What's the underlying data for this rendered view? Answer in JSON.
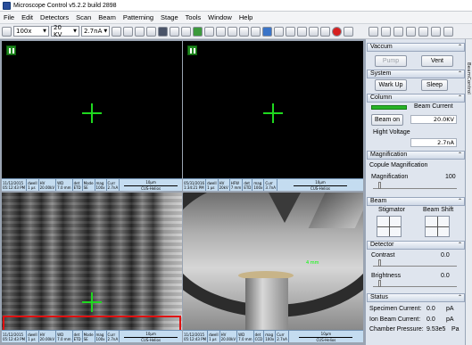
{
  "window": {
    "title": "Microscope Control v5.2.2 build 2898"
  },
  "menu": [
    "File",
    "Edit",
    "Detectors",
    "Scan",
    "Beam",
    "Patterning",
    "Stage",
    "Tools",
    "Window",
    "Help"
  ],
  "toolbar": {
    "magnification": "100x",
    "voltage": "20 KV",
    "current": "2.7nA"
  },
  "views": [
    {
      "info": [
        "11/12/2015",
        "05:12:43 PM",
        "dwell",
        "1 µs",
        "HV",
        "20.00kV",
        "WD",
        "7.0 mm",
        "det",
        "ETD",
        "Mode",
        "SE",
        "mag",
        "100x",
        "Curr",
        "2.7nA"
      ],
      "scale": "10µm",
      "footer": "CUS-Helios"
    },
    {
      "info": [
        "05/31/2016",
        "1:34:21 PM",
        "dwell",
        "1 µs",
        "HV",
        "20kV",
        "HFW",
        "7 mm",
        "det",
        "ETD",
        "mag",
        "100x",
        "Curr",
        "3.7nA"
      ],
      "scale": "10µm",
      "footer": "CUS-Helios"
    },
    {
      "info": [
        "11/12/2015",
        "05:12:43 PM",
        "dwell",
        "1 µs",
        "HV",
        "20.00kV",
        "WD",
        "7.0 mm",
        "det",
        "ETD",
        "Mode",
        "SE",
        "mag",
        "100x",
        "Curr",
        "2.7nA"
      ],
      "scale": "10µm",
      "footer": "CUS-Helios"
    },
    {
      "info": [
        "11/12/2015",
        "05:12:43 PM",
        "dwell",
        "1 µs",
        "HV",
        "20.00kV",
        "WD",
        "7.0 mm",
        "det",
        "CCD",
        "mag",
        "100x",
        "Curr",
        "2.7nA"
      ],
      "scale": "10µm",
      "footer": "CUS-Helios",
      "overlay": "4 mm"
    }
  ],
  "panel": {
    "vaccum": {
      "title": "Vaccum",
      "pump": "Pump",
      "vent": "Vent"
    },
    "system": {
      "title": "System",
      "warkup": "Wark Up",
      "sleep": "Sleep"
    },
    "column": {
      "title": "Column",
      "beam_current": "Beam Current",
      "beam_on": "Beam on",
      "kv": "20.0KV",
      "hight_voltage": "Hight Voltage",
      "na": "2.7nA"
    },
    "magnification": {
      "title": "Magnification",
      "copule": "Copule Magnification",
      "label": "Magnification",
      "value": "100"
    },
    "beam": {
      "title": "Beam",
      "stigmator": "Stigmator",
      "beam_shift": "Beam Shift"
    },
    "detector": {
      "title": "Detector",
      "contrast": "Contrast",
      "contrast_val": "0.0",
      "brightness": "Brightness",
      "brightness_val": "0.0"
    },
    "status": {
      "title": "Status",
      "specimen": "Specimen Current:",
      "specimen_val": "0.0",
      "specimen_unit": "pA",
      "ion": "Ion Beam Current:",
      "ion_val": "0.0",
      "ion_unit": "pA",
      "chamber": "Chamber Pressure:",
      "chamber_val": "9.53e5",
      "chamber_unit": "Pa"
    }
  },
  "side_tab": "BeamControl"
}
